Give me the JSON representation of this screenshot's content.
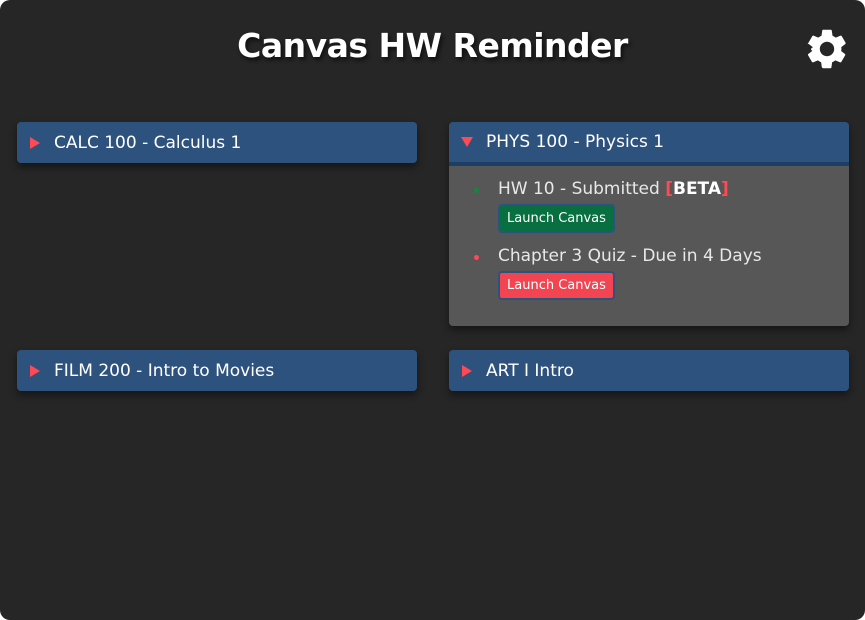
{
  "app": {
    "title": "Canvas HW Reminder",
    "settings_icon": "gear-icon"
  },
  "colors": {
    "background": "#262626",
    "header": "#2e527e",
    "panel": "#575757",
    "accent_red": "#ff4a55",
    "launch_green": "#087040",
    "launch_red": "#f24451"
  },
  "courses": [
    {
      "name": "CALC 100 - Calculus 1",
      "expanded": false,
      "assignments": []
    },
    {
      "name": "PHYS 100 - Physics 1",
      "expanded": true,
      "assignments": [
        {
          "text": "HW 10 - Submitted",
          "badge": "BETA",
          "badge_open": "[",
          "badge_close": "]",
          "status": "submitted",
          "button": "Launch Canvas"
        },
        {
          "text": "Chapter 3 Quiz - Due in 4 Days",
          "status": "due",
          "button": "Launch Canvas"
        }
      ]
    },
    {
      "name": "FILM 200 - Intro to Movies",
      "expanded": false,
      "assignments": []
    },
    {
      "name": "ART I Intro",
      "expanded": false,
      "assignments": []
    }
  ]
}
